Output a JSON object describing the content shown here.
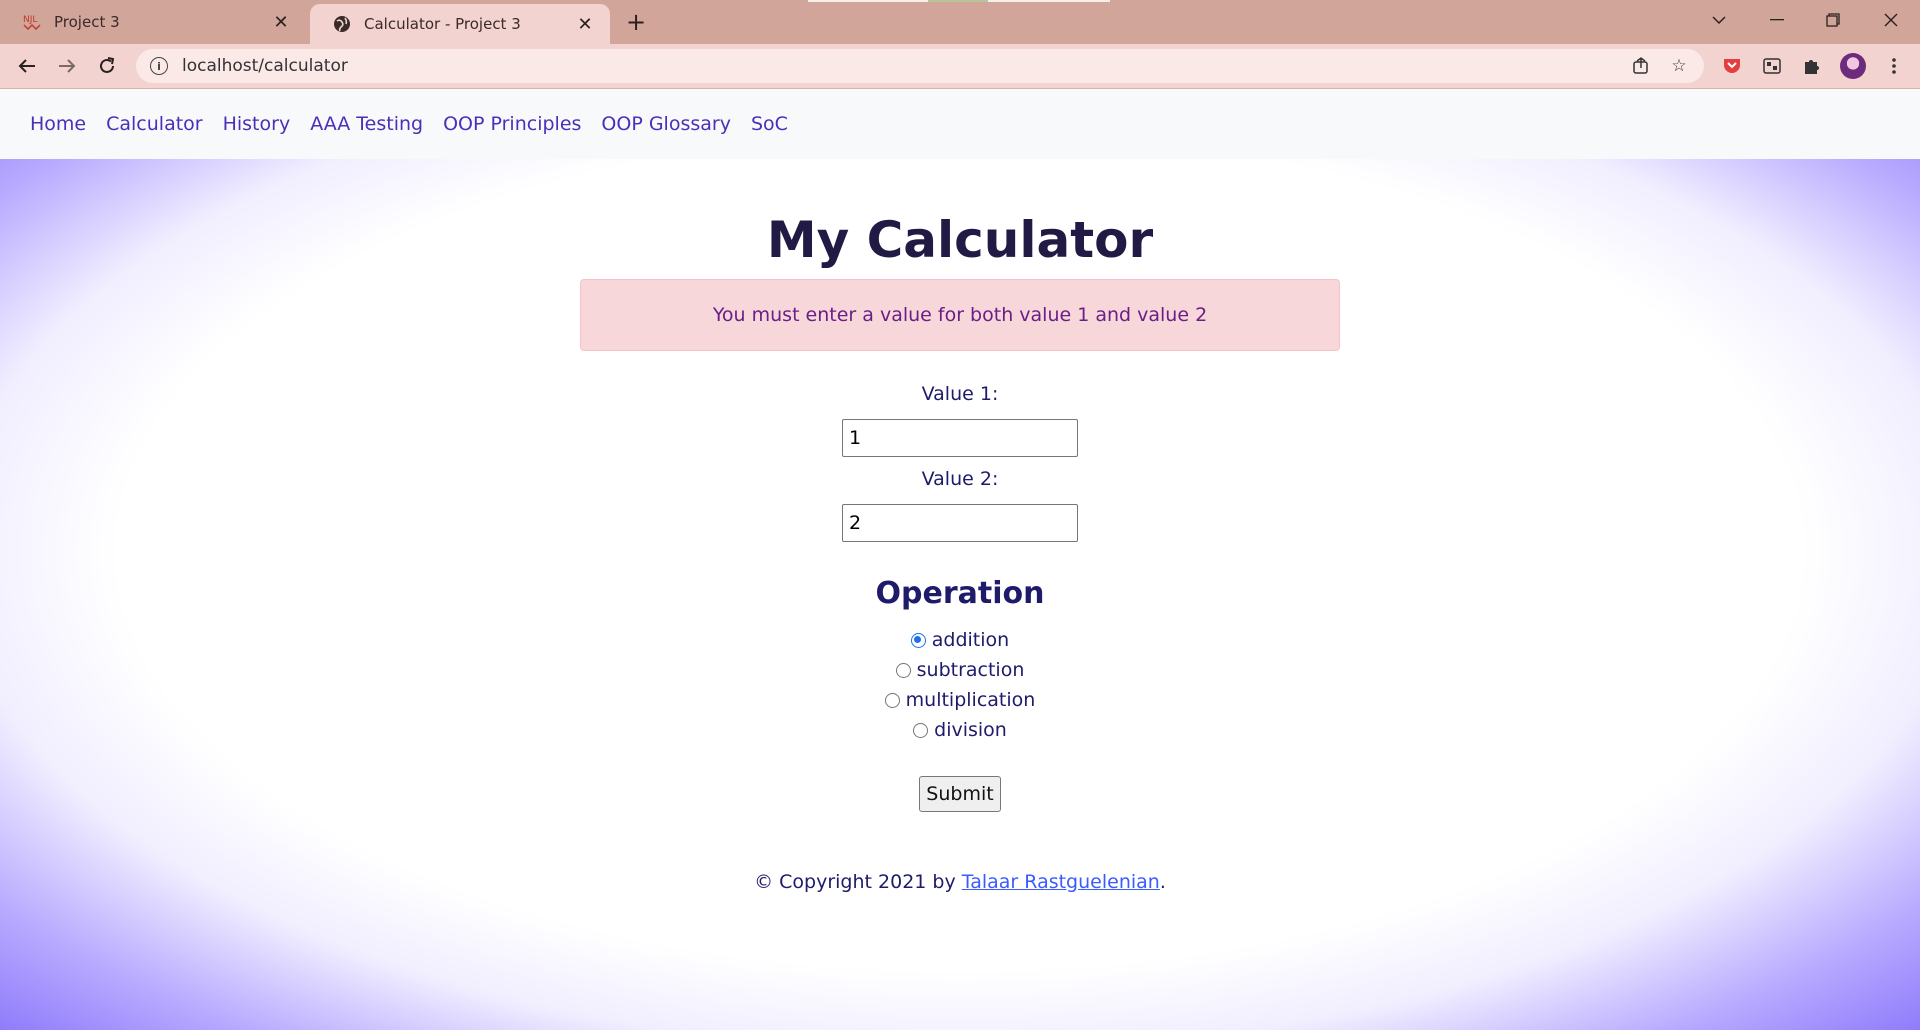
{
  "browser": {
    "tabs": [
      {
        "title": "Project 3",
        "active": false
      },
      {
        "title": "Calculator - Project 3",
        "active": true
      }
    ],
    "url": "localhost/calculator",
    "colors": {
      "tabstrip": "#d2a59b",
      "toolbar": "#f3d3d0"
    }
  },
  "nav": {
    "links": [
      "Home",
      "Calculator",
      "History",
      "AAA Testing",
      "OOP Principles",
      "OOP Glossary",
      "SoC"
    ],
    "link_color": "#4b2fb8"
  },
  "main": {
    "title": "My Calculator",
    "alert": "You must enter a value for both value 1 and value 2",
    "value1": {
      "label": "Value 1:",
      "value": "1"
    },
    "value2": {
      "label": "Value 2:",
      "value": "2"
    },
    "operation": {
      "heading": "Operation",
      "options": [
        "addition",
        "subtraction",
        "multiplication",
        "division"
      ],
      "selected": "addition"
    },
    "submit_label": "Submit"
  },
  "footer": {
    "prefix": "© Copyright 2021 by ",
    "author": "Talaar Rastguelenian",
    "suffix": "."
  }
}
